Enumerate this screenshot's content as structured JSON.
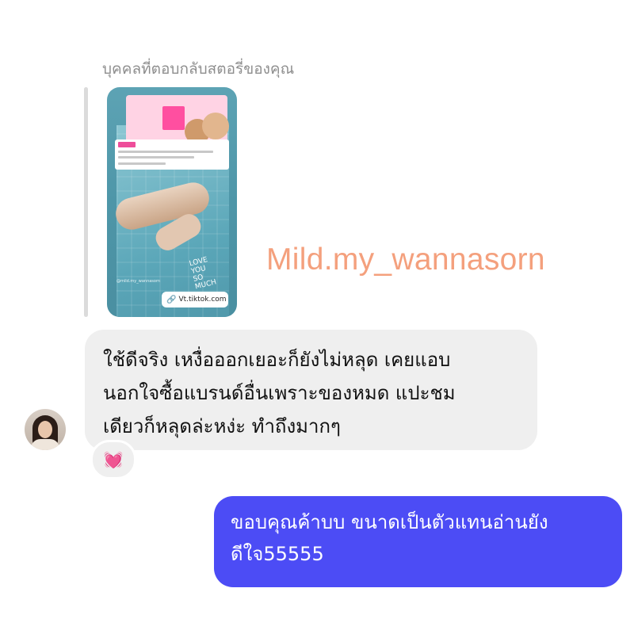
{
  "story_reply": {
    "caption": "บุคคลที่ตอบกลับสตอรี่ของคุณ",
    "link_chip": "Vt.tiktok.com",
    "link_icon": "link-icon",
    "handle": "@mild.my_wannasorn",
    "doodle_lines": [
      "LOVE",
      "YOU",
      "SO",
      "MUCH"
    ]
  },
  "watermark": "Mild.my_wannasorn",
  "incoming_message": {
    "lines": [
      "ใช้ดีจริง เหงื่อออกเยอะก็ยังไม่หลุด เคยแอบ",
      "นอกใจซื้อแบรนด์อื่นเพราะของหมด แปะชม",
      "เดียวก็หลุดล่ะหง่ะ ทำถึงมากๆ"
    ],
    "reaction": "💓"
  },
  "outgoing_message": {
    "lines": [
      "ขอบคุณค้าบบ ขนาดเป็นตัวแทนอ่านยัง",
      "ดีใจ55555"
    ]
  },
  "colors": {
    "outgoing_bubble": "#4c4cf5",
    "incoming_bubble": "#efefef",
    "watermark": "#f4a07d"
  }
}
